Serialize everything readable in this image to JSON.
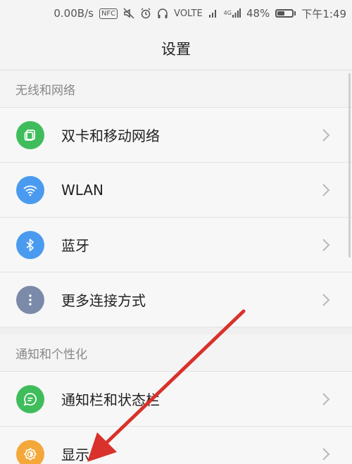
{
  "status_bar": {
    "speed": "0.00B/s",
    "nfc": "NFC",
    "network": "VOLTE",
    "signal_label": "4G",
    "battery": "48%",
    "battery_level": 0.48,
    "time": "下午1:49"
  },
  "title": "设置",
  "sections": [
    {
      "header": "无线和网络",
      "items": [
        {
          "label": "双卡和移动网络",
          "icon": "dual-sim-icon",
          "color": "#3fbd5c"
        },
        {
          "label": "WLAN",
          "icon": "wifi-icon",
          "color": "#4a9bf0"
        },
        {
          "label": "蓝牙",
          "icon": "bluetooth-icon",
          "color": "#4a9bf0"
        },
        {
          "label": "更多连接方式",
          "icon": "more-dots-icon",
          "color": "#7b8aa8"
        }
      ]
    },
    {
      "header": "通知和个性化",
      "items": [
        {
          "label": "通知栏和状态栏",
          "icon": "message-bubble-icon",
          "color": "#3fbd5c"
        },
        {
          "label": "显示",
          "icon": "brightness-icon",
          "color": "#f4a83a"
        }
      ]
    }
  ],
  "annotation": {
    "type": "arrow",
    "color": "#d9312b",
    "target": "显示"
  }
}
